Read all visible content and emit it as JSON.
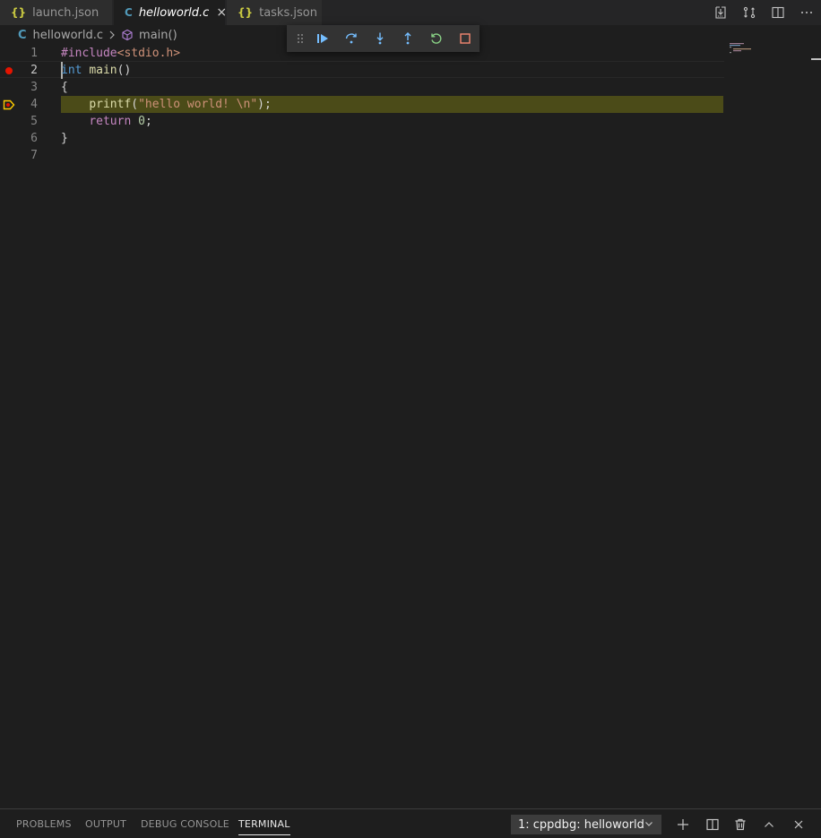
{
  "tabs": [
    {
      "label": "launch.json",
      "icon": "json-braces-icon",
      "glyph": "{}",
      "active": false
    },
    {
      "label": "helloworld.c",
      "icon": "c-file-icon",
      "glyph": "C",
      "active": true
    },
    {
      "label": "tasks.json",
      "icon": "json-braces-icon",
      "glyph": "{}",
      "active": false
    }
  ],
  "tab_close_glyph": "×",
  "breadcrumb": {
    "file_glyph": "C",
    "file": "helloworld.c",
    "symbol": "main()"
  },
  "debug_toolbar": {
    "buttons": [
      "continue",
      "step-over",
      "step-into",
      "step-out",
      "restart",
      "stop"
    ]
  },
  "editor": {
    "lines": [
      {
        "num": "1",
        "tokens": [
          {
            "t": "#include",
            "c": "pre"
          },
          {
            "t": "<stdio.h>",
            "c": "inc"
          }
        ]
      },
      {
        "num": "2",
        "tokens": [
          {
            "t": "int",
            "c": "kw"
          },
          {
            "t": " ",
            "c": "punc"
          },
          {
            "t": "main",
            "c": "fn"
          },
          {
            "t": "()",
            "c": "punc"
          }
        ],
        "breakpoint": true,
        "cursor": true
      },
      {
        "num": "3",
        "tokens": [
          {
            "t": "{",
            "c": "punc"
          }
        ]
      },
      {
        "num": "4",
        "tokens": [
          {
            "t": "    ",
            "c": "punc"
          },
          {
            "t": "printf",
            "c": "fn"
          },
          {
            "t": "(",
            "c": "punc"
          },
          {
            "t": "\"hello world! \\n\"",
            "c": "str"
          },
          {
            "t": ");",
            "c": "punc"
          }
        ],
        "debug_current": true
      },
      {
        "num": "5",
        "tokens": [
          {
            "t": "    ",
            "c": "punc"
          },
          {
            "t": "return",
            "c": "ret"
          },
          {
            "t": " ",
            "c": "punc"
          },
          {
            "t": "0",
            "c": "num"
          },
          {
            "t": ";",
            "c": "punc"
          }
        ]
      },
      {
        "num": "6",
        "tokens": [
          {
            "t": "}",
            "c": "punc"
          }
        ]
      },
      {
        "num": "7",
        "tokens": []
      }
    ]
  },
  "panel": {
    "tabs": [
      "PROBLEMS",
      "OUTPUT",
      "DEBUG CONSOLE",
      "TERMINAL"
    ],
    "active_tab": "TERMINAL",
    "terminal_select": "1: cppdbg: helloworld"
  },
  "colors": {
    "breakpoint": "#e51400",
    "debug_line_highlight": "#4b4b18",
    "debug_arrow": "#ffcc00"
  }
}
